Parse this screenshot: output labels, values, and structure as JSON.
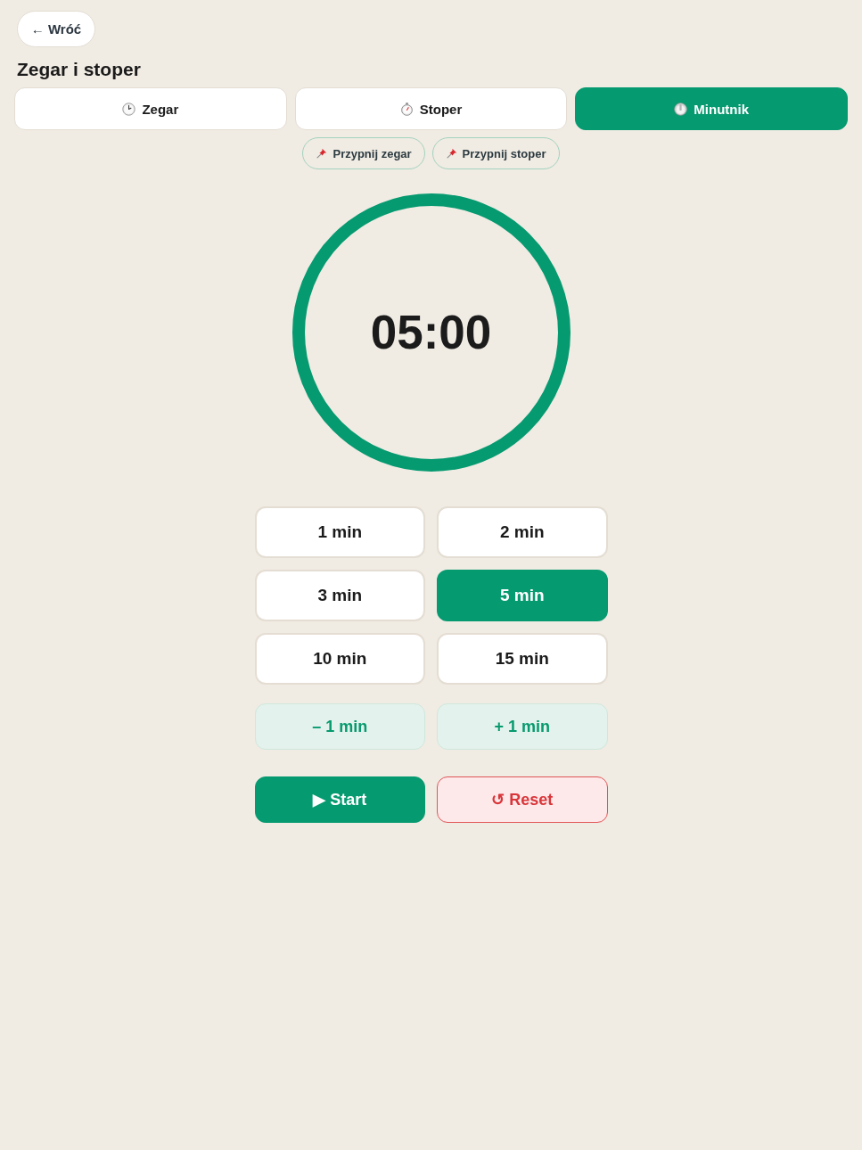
{
  "back_button": {
    "label": "← Wróć"
  },
  "title": "Zegar i stoper",
  "tabs": [
    {
      "label": "Zegar",
      "selected": false
    },
    {
      "label": "Stoper",
      "selected": false
    },
    {
      "label": "Minutnik",
      "selected": true
    }
  ],
  "pins": [
    {
      "label": "Przypnij zegar"
    },
    {
      "label": "Przypnij stoper"
    }
  ],
  "timer": {
    "display": "05:00",
    "level": 1
  },
  "presets": [
    {
      "label": "1 min",
      "selected": false
    },
    {
      "label": "2 min",
      "selected": false
    },
    {
      "label": "3 min",
      "selected": false
    },
    {
      "label": "5 min",
      "selected": true
    },
    {
      "label": "10 min",
      "selected": false
    },
    {
      "label": "15 min",
      "selected": false
    }
  ],
  "adjust": [
    {
      "label": "– 1 min"
    },
    {
      "label": "+ 1 min"
    }
  ],
  "actions": [
    {
      "label": "▶ Start",
      "kind": "primary"
    },
    {
      "label": "↺ Reset",
      "kind": "danger"
    }
  ]
}
